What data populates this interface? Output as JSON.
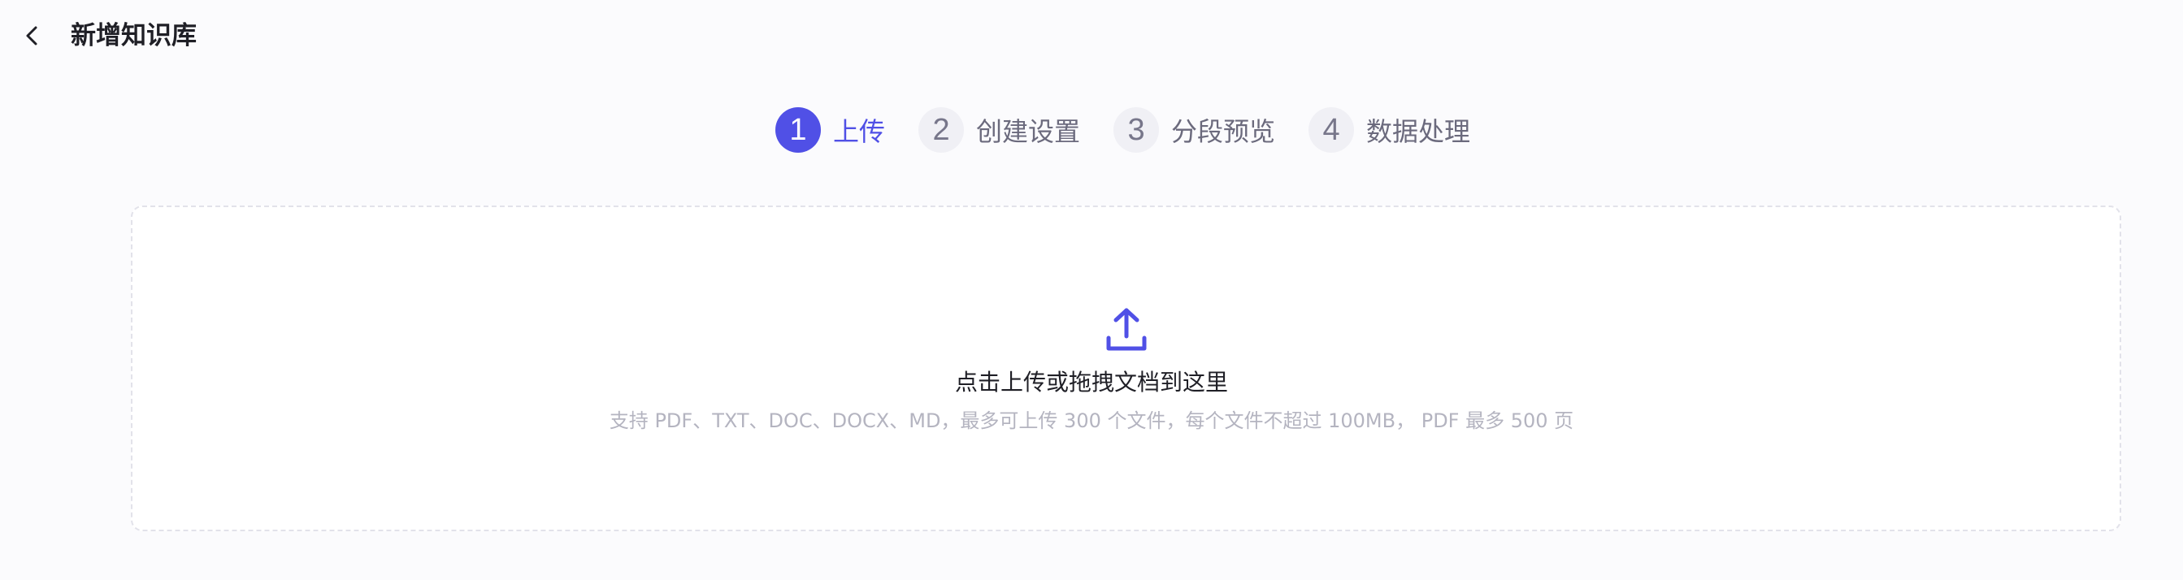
{
  "header": {
    "back_icon": "chevron-left-icon",
    "title": "新增知识库"
  },
  "steps": [
    {
      "number": "1",
      "label": "上传",
      "active": true
    },
    {
      "number": "2",
      "label": "创建设置",
      "active": false
    },
    {
      "number": "3",
      "label": "分段预览",
      "active": false
    },
    {
      "number": "4",
      "label": "数据处理",
      "active": false
    }
  ],
  "upload": {
    "icon": "upload-icon",
    "title": "点击上传或拖拽文档到这里",
    "hint": "支持 PDF、TXT、DOC、DOCX、MD，最多可上传 300 个文件，每个文件不超过 100MB， PDF 最多 500 页"
  },
  "colors": {
    "accent": "#5050e6",
    "background": "#fbfbfd",
    "step_inactive_bg": "#f0f0f5",
    "hint_text": "#b4b4c0"
  }
}
